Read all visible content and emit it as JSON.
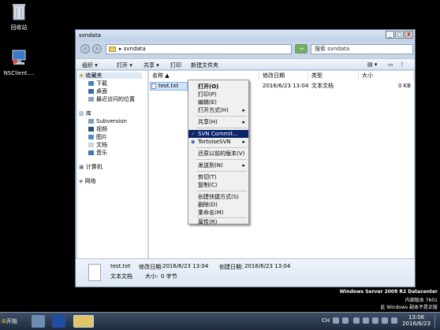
{
  "desktop": {
    "icons": [
      {
        "label": "回收站",
        "icon": "recycle-bin-icon"
      },
      {
        "label": "NSClient....",
        "icon": "nsclient-icon"
      }
    ]
  },
  "window": {
    "title": "svndata",
    "address": "svndata",
    "address_prefix": "▸",
    "search_placeholder": "搜索 svndata",
    "buttons": {
      "minimize": "_",
      "maximize": "□",
      "close": "X"
    }
  },
  "toolbar": {
    "organize": "组织 ▾",
    "open": "打开 ▾",
    "share": "共享 ▾",
    "print": "打印",
    "new_folder": "新建文件夹"
  },
  "nav": {
    "favorites": "收藏夹",
    "favorites_items": [
      "下载",
      "桌面",
      "最近访问的位置"
    ],
    "libraries": "库",
    "libraries_items": [
      "Subversion",
      "视频",
      "图片",
      "文档",
      "音乐"
    ],
    "computer": "计算机",
    "network": "网络"
  },
  "columns": {
    "name": "名称 ▲",
    "modified": "修改日期",
    "type": "类型",
    "size": "大小"
  },
  "file": {
    "name": "test.txt",
    "modified": "2016/6/23 13:04",
    "type": "文本文档",
    "size": "0 KB"
  },
  "context_menu": {
    "items": [
      {
        "label": "打开(O)",
        "bold": true
      },
      {
        "label": "打印(P)"
      },
      {
        "label": "编辑(E)"
      },
      {
        "label": "打开方式(H)",
        "submenu": true
      },
      {
        "label": "共享(H)",
        "submenu": true
      },
      {
        "label": "SVN Commit...",
        "highlight": true
      },
      {
        "label": "TortoiseSVN",
        "submenu": true
      },
      {
        "label": "还原以前的版本(V)"
      },
      {
        "label": "发送到(N)",
        "submenu": true
      },
      {
        "label": "剪切(T)"
      },
      {
        "label": "复制(C)"
      },
      {
        "label": "创建快捷方式(S)"
      },
      {
        "label": "删除(D)"
      },
      {
        "label": "重命名(M)"
      },
      {
        "label": "属性(R)"
      }
    ]
  },
  "details": {
    "name": "test.txt",
    "modified_label": "修改日期:",
    "modified": "2016/6/23 13:04",
    "created_label": "创建日期:",
    "created": "2016/6/23 13:04",
    "type": "文本文档",
    "size_label": "大小:",
    "size": "0 字节"
  },
  "watermark": {
    "line1": "Windows Server 2008 R2 Datacenter",
    "line2": "内部版本 7601",
    "line3": "此 Windows 副本不是正版"
  },
  "taskbar": {
    "start": "开始",
    "lang": "CH",
    "time": "13:06",
    "date": "2016/6/23"
  }
}
